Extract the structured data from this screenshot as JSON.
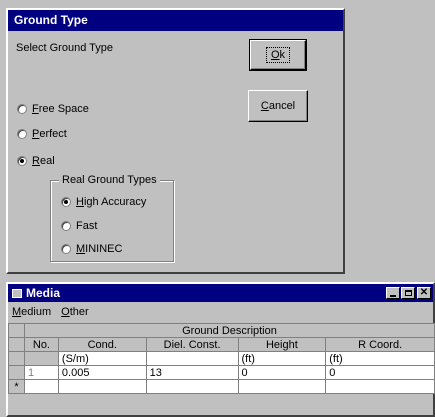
{
  "ground_dialog": {
    "title": "Ground Type",
    "prompt": "Select Ground Type",
    "ok_label": "Ok",
    "cancel_label": "Cancel",
    "options": [
      {
        "label": "Free Space",
        "selected": false
      },
      {
        "label": "Perfect",
        "selected": false
      },
      {
        "label": "Real",
        "selected": true
      }
    ],
    "real_group": {
      "legend": "Real Ground Types",
      "options": [
        {
          "label": "High Accuracy",
          "selected": true
        },
        {
          "label": "Fast",
          "selected": false
        },
        {
          "label": "MININEC",
          "selected": false
        }
      ]
    }
  },
  "media_window": {
    "title": "Media",
    "menu": [
      "Medium",
      "Other"
    ],
    "grid": {
      "group_header": "Ground Description",
      "columns": [
        "No.",
        "Cond.",
        "Diel. Const.",
        "Height",
        "R Coord."
      ],
      "units": [
        "",
        "(S/m)",
        "",
        "(ft)",
        "(ft)"
      ],
      "rows": [
        [
          "1",
          "0.005",
          "13",
          "0",
          "0"
        ]
      ],
      "new_row_marker": "*"
    }
  }
}
